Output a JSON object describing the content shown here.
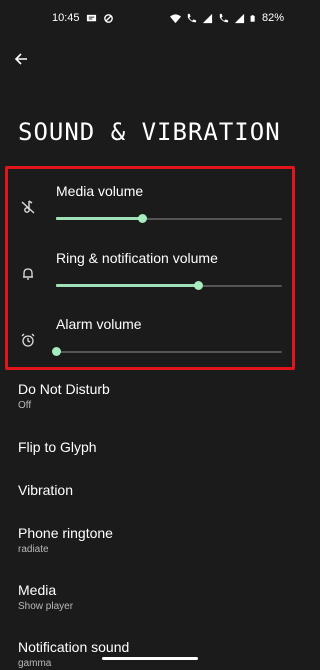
{
  "status_bar": {
    "time": "10:45",
    "battery": "82%",
    "icons": [
      "message-icon",
      "sync-icon",
      "wifi-icon",
      "call-icon",
      "signal-icon",
      "call-icon",
      "signal-icon",
      "battery-icon"
    ]
  },
  "header": {
    "back_icon": "arrow-left-icon",
    "title": "SOUND & VIBRATION"
  },
  "volumes": [
    {
      "label": "Media volume",
      "icon": "media-muted-icon",
      "level": 0.38
    },
    {
      "label": "Ring & notification volume",
      "icon": "bell-icon",
      "level": 0.63
    },
    {
      "label": "Alarm volume",
      "icon": "alarm-clock-icon",
      "level": 0.0
    }
  ],
  "settings": [
    {
      "title": "Do Not Disturb",
      "subtitle": "Off"
    },
    {
      "title": "Flip to Glyph"
    },
    {
      "title": "Vibration"
    },
    {
      "title": "Phone ringtone",
      "subtitle": "radiate"
    },
    {
      "title": "Media",
      "subtitle": "Show player"
    },
    {
      "title": "Notification sound",
      "subtitle": "gamma"
    }
  ],
  "colors": {
    "background": "#1b1b1b",
    "accent": "#a6ecc0",
    "highlight_border": "#e0161c"
  }
}
